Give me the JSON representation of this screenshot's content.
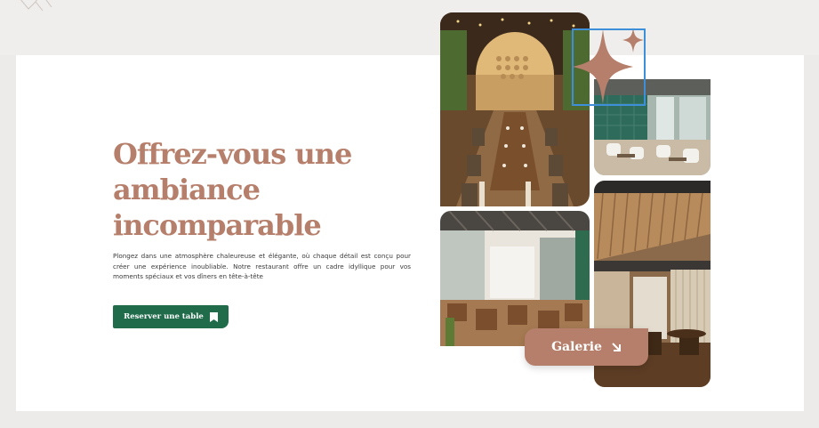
{
  "hero": {
    "heading_line1": "Offrez-vous une",
    "heading_line2": "ambiance",
    "heading_line3": "incomparable",
    "paragraph": "Plongez dans une atmosphère chaleureuse et élégante, où chaque détail est conçu pour créer une expérience inoubliable. Notre restaurant offre un cadre idyllique pour vos moments spéciaux et vos dîners en tête-à-tête",
    "reserve_label": "Reserver une table",
    "reserve_icon": "bookmark-icon"
  },
  "gallery": {
    "button_label": "Galerie",
    "button_icon": "arrow-down-right-icon",
    "decoration_icon": "sparkle-icon"
  },
  "colors": {
    "accent": "#b67f6b",
    "primary_button": "#1f6b4a",
    "selection_outline": "#3d8fd9"
  }
}
